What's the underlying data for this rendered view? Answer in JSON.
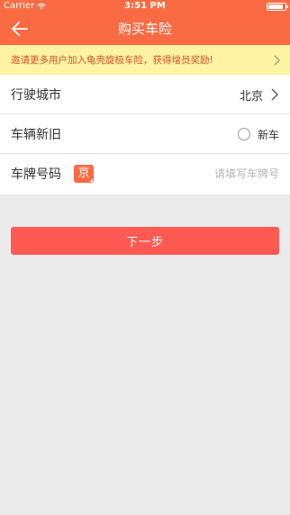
{
  "status_bar": {
    "carrier": "Carrier",
    "time": "3:51 PM",
    "battery_level": 0.9
  },
  "nav": {
    "title": "购买车险"
  },
  "notice": {
    "text": "邀请更多用户加入龟壳旋极车险，获得增员奖励!"
  },
  "form": {
    "city": {
      "label": "行驶城市",
      "value": "北京"
    },
    "vehicle": {
      "label": "车辆新旧",
      "new_label": "新车",
      "new_checked": false
    },
    "plate": {
      "label": "车牌号码",
      "prefix": "京",
      "placeholder": "请填写车牌号",
      "value": ""
    }
  },
  "actions": {
    "next_label": "下一步"
  },
  "colors": {
    "primary": "#fb6b43",
    "notice_bg": "#fdf3a3",
    "notice_text": "#d8502a",
    "button": "#ff5a52",
    "page_bg": "#ebebeb"
  }
}
